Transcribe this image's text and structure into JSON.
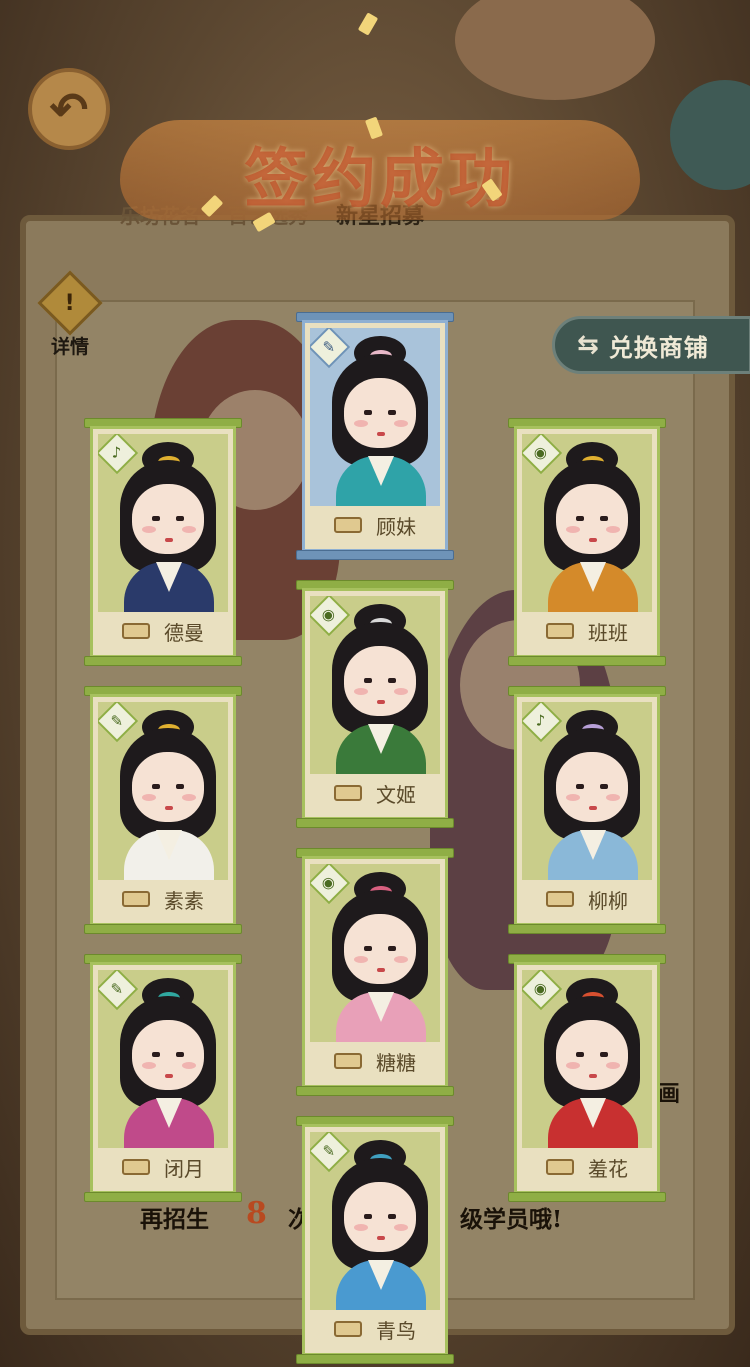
{
  "topbar": {
    "back_icon": "back-arrow-icon",
    "tabs": [
      {
        "label": "乐坊花名"
      },
      {
        "label": "百艺选秀"
      },
      {
        "label": "新星招募",
        "active": true
      }
    ]
  },
  "banner": {
    "title": "签约成功"
  },
  "details_button": {
    "label": "详情",
    "icon": "exclamation-icon"
  },
  "shop_button": {
    "label": "兑换商铺",
    "icon": "exchange-arrows-icon"
  },
  "hint": {
    "prefix": "再招生",
    "count": "8",
    "middle": "次",
    "suffix": "级学员哦!"
  },
  "side_word": "画",
  "colors": {
    "card_green": "#8fae45",
    "card_blue": "#6e93b8",
    "hint_number": "#b84a20"
  },
  "cards": [
    {
      "name": "顾妹",
      "frame": "blue",
      "badge_icon": "brush-pen-icon",
      "robe_color": "#2fa3a8",
      "ornament_color": "#e8b8c8"
    },
    {
      "name": "德曼",
      "frame": "green",
      "badge_icon": "pipa-lute-icon",
      "robe_color": "#2a3a6a",
      "ornament_color": "#e0b030"
    },
    {
      "name": "班班",
      "frame": "green",
      "badge_icon": "drum-icon",
      "robe_color": "#d48a2a",
      "ornament_color": "#e0b030"
    },
    {
      "name": "文姬",
      "frame": "green",
      "badge_icon": "drum-icon",
      "robe_color": "#3a7a3a",
      "ornament_color": "#d8d8d8"
    },
    {
      "name": "素素",
      "frame": "green",
      "badge_icon": "brush-pen-icon",
      "robe_color": "#f2f0ea",
      "ornament_color": "#e0b030"
    },
    {
      "name": "柳柳",
      "frame": "green",
      "badge_icon": "pipa-lute-icon",
      "robe_color": "#8ab8d8",
      "ornament_color": "#b8a0d8"
    },
    {
      "name": "糖糖",
      "frame": "green",
      "badge_icon": "drum-icon",
      "robe_color": "#e8a0b8",
      "ornament_color": "#d86080"
    },
    {
      "name": "闭月",
      "frame": "green",
      "badge_icon": "brush-pen-icon",
      "robe_color": "#c04a8a",
      "ornament_color": "#30a8a0"
    },
    {
      "name": "羞花",
      "frame": "green",
      "badge_icon": "drum-icon",
      "robe_color": "#c83030",
      "ornament_color": "#d85030"
    },
    {
      "name": "青鸟",
      "frame": "green",
      "badge_icon": "brush-pen-icon",
      "robe_color": "#4a9ad0",
      "ornament_color": "#40a0c0"
    }
  ]
}
